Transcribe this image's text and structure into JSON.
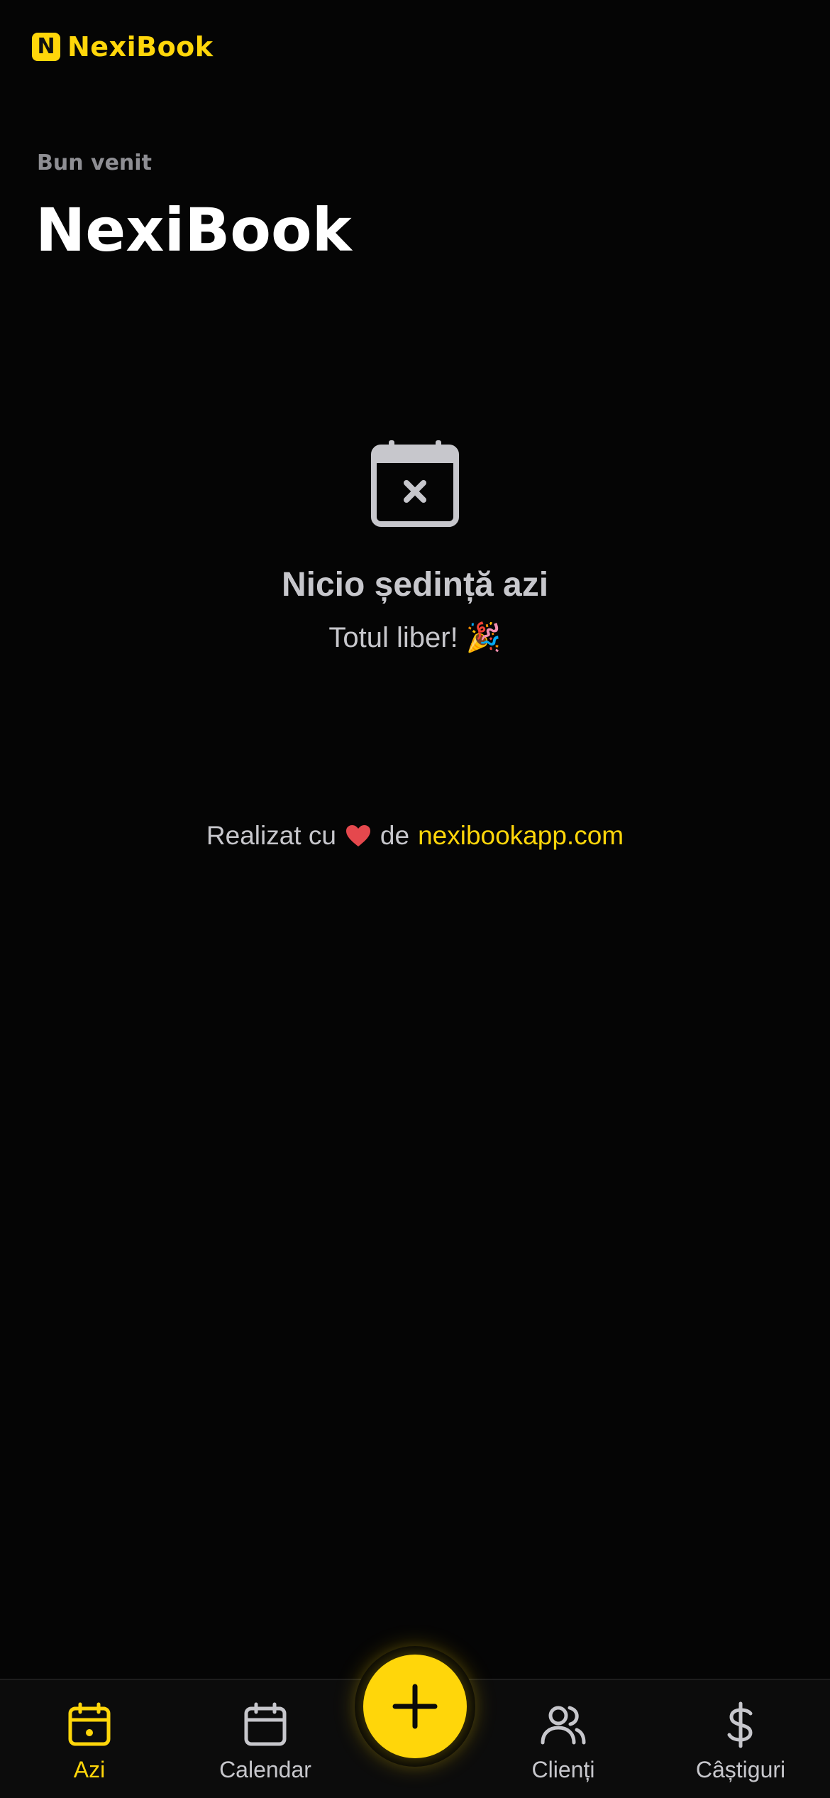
{
  "app": {
    "brand_letter": "N",
    "brand_name": "NexiBook",
    "accent_color": "#FFD60A"
  },
  "header": {
    "welcome": "Bun venit",
    "title": "NexiBook"
  },
  "empty_state": {
    "icon": "calendar-x-icon",
    "title": "Nicio ședință azi",
    "subtitle": "Totul liber! 🎉"
  },
  "credit": {
    "prefix": "Realizat cu",
    "heart_icon": "heart-icon",
    "middle": "de",
    "link": "nexibookapp.com"
  },
  "bottom_nav": {
    "items": [
      {
        "label": "Azi",
        "icon": "calendar-dot-icon",
        "active": true
      },
      {
        "label": "Calendar",
        "icon": "calendar-icon",
        "active": false
      },
      {
        "label": "Clienți",
        "icon": "users-icon",
        "active": false
      },
      {
        "label": "Câștiguri",
        "icon": "dollar-icon",
        "active": false
      }
    ],
    "fab_icon": "plus-icon"
  }
}
